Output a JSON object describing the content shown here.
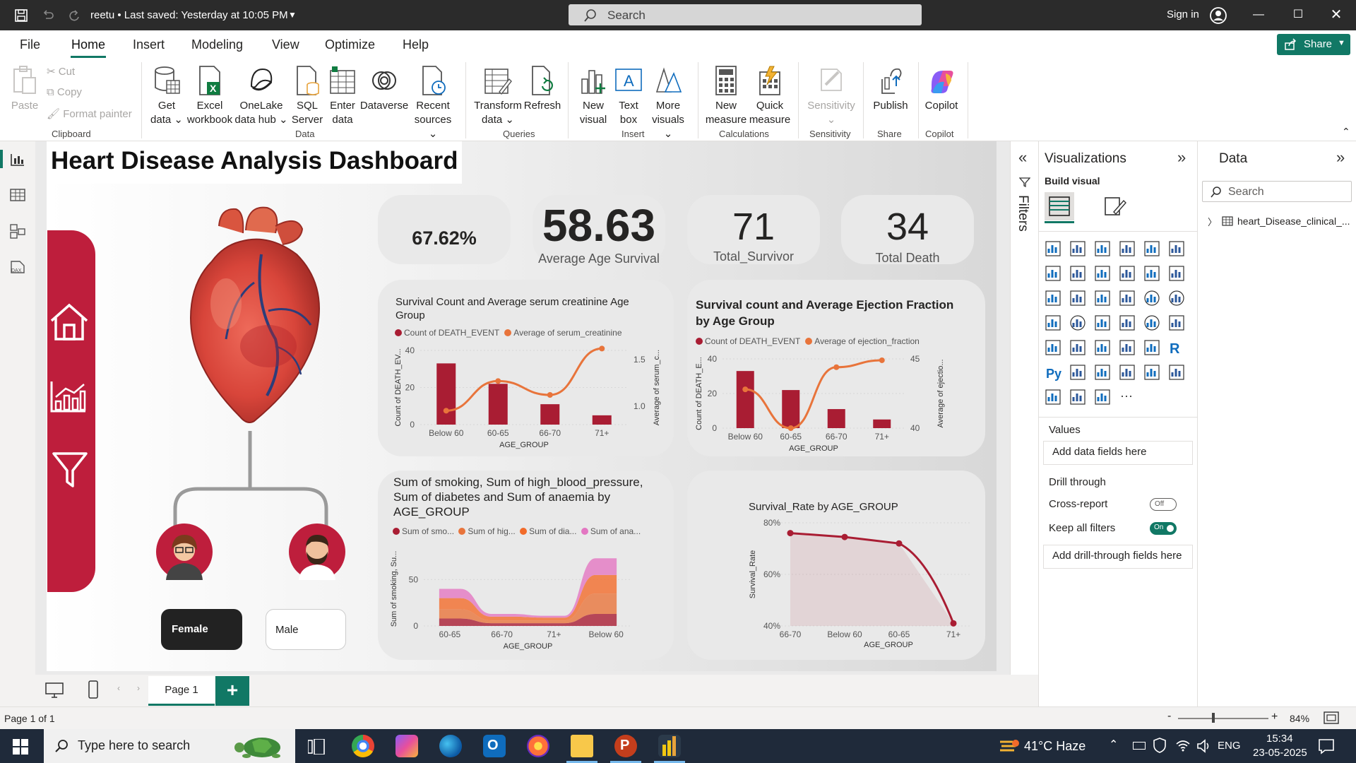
{
  "titlebar": {
    "doc_title": "reetu • Last saved: Yesterday at 10:05 PM",
    "search_placeholder": "Search",
    "signin": "Sign in"
  },
  "menu": {
    "items": [
      "File",
      "Home",
      "Insert",
      "Modeling",
      "View",
      "Optimize",
      "Help"
    ],
    "active": "Home",
    "share": "Share"
  },
  "ribbon": {
    "clipboard": {
      "paste": "Paste",
      "cut": "Cut",
      "copy": "Copy",
      "format_painter": "Format painter",
      "label": "Clipboard"
    },
    "data": {
      "get_data": [
        "Get",
        "data"
      ],
      "excel": [
        "Excel",
        "workbook"
      ],
      "onelake": [
        "OneLake",
        "data hub"
      ],
      "sql": [
        "SQL",
        "Server"
      ],
      "enter": [
        "Enter",
        "data"
      ],
      "dataverse": [
        "Dataverse",
        ""
      ],
      "recent": [
        "Recent",
        "sources"
      ],
      "label": "Data"
    },
    "queries": {
      "transform": [
        "Transform",
        "data"
      ],
      "refresh": [
        "Refresh",
        ""
      ],
      "label": "Queries"
    },
    "insert": {
      "new_visual": [
        "New",
        "visual"
      ],
      "text_box": [
        "Text",
        "box"
      ],
      "more_visuals": [
        "More",
        "visuals"
      ],
      "label": "Insert"
    },
    "calculations": {
      "new_measure": [
        "New",
        "measure"
      ],
      "quick_measure": [
        "Quick",
        "measure"
      ],
      "label": "Calculations"
    },
    "sensitivity": {
      "btn": "Sensitivity",
      "label": "Sensitivity"
    },
    "share": {
      "publish": "Publish",
      "label": "Share"
    },
    "copilot": {
      "btn": "Copilot",
      "label": "Copilot"
    }
  },
  "report": {
    "title": "Heart Disease Analysis Dashboard",
    "kpis": [
      {
        "value": "67.62%",
        "label": ""
      },
      {
        "value": "58.63",
        "label": "Average Age Survival"
      },
      {
        "value": "71",
        "label": "Total_Survivor"
      },
      {
        "value": "34",
        "label": "Total Death"
      }
    ],
    "gender_buttons": {
      "female": "Female",
      "male": "Male"
    }
  },
  "colors": {
    "bar": "#a91d33",
    "line": "#e8743b",
    "accent": "#be1e3c",
    "teal": "#117865",
    "pink": "#e377c2"
  },
  "chart_data": [
    {
      "type": "bar",
      "title": "Survival Count and Average serum creatinine Age Group",
      "legend": [
        "Count of DEATH_EVENT",
        "Average of serum_creatinine"
      ],
      "categories": [
        "Below 60",
        "60-65",
        "66-70",
        "71+"
      ],
      "series": [
        {
          "name": "Count of DEATH_EVENT",
          "values": [
            33,
            22,
            11,
            5
          ],
          "type": "bar"
        },
        {
          "name": "Average of serum_creatinine",
          "values": [
            0.95,
            1.27,
            1.12,
            1.62
          ],
          "type": "line"
        }
      ],
      "xlabel": "AGE_GROUP",
      "ylabel": "Count of DEATH_EV...",
      "y2label": "Average of serum_c...",
      "yticks": [
        "0",
        "20",
        "40"
      ],
      "y2ticks": [
        "1.0",
        "1.5"
      ],
      "ylim": [
        0,
        40
      ],
      "y2lim": [
        0.8,
        1.6
      ]
    },
    {
      "type": "bar",
      "title": "Survival count and Average Ejection Fraction by Age Group",
      "legend": [
        "Count of DEATH_EVENT",
        "Average of ejection_fraction"
      ],
      "categories": [
        "Below 60",
        "60-65",
        "66-70",
        "71+"
      ],
      "series": [
        {
          "name": "Count of DEATH_EVENT",
          "values": [
            33,
            22,
            11,
            5
          ],
          "type": "bar"
        },
        {
          "name": "Average of ejection_fraction",
          "values": [
            42.8,
            40.0,
            44.4,
            44.9
          ],
          "type": "line"
        }
      ],
      "xlabel": "AGE_GROUP",
      "ylabel": "Count of DEATH_E...",
      "y2label": "Average of ejectio...",
      "yticks": [
        "0",
        "20",
        "40"
      ],
      "y2ticks": [
        "40",
        "45"
      ],
      "ylim": [
        0,
        40
      ],
      "y2lim": [
        40,
        45
      ]
    },
    {
      "type": "area",
      "title": "Sum of smoking, Sum of high_blood_pressure, Sum of diabetes and Sum of anaemia by AGE_GROUP",
      "legend": [
        "Sum of smo...",
        "Sum of hig...",
        "Sum of dia...",
        "Sum of ana..."
      ],
      "categories": [
        "60-65",
        "66-70",
        "71+",
        "Below 60"
      ],
      "series": [
        {
          "name": "Sum of smo...",
          "values": [
            8,
            3,
            3,
            13
          ]
        },
        {
          "name": "Sum of hig...",
          "values": [
            10,
            3,
            3,
            22
          ]
        },
        {
          "name": "Sum of dia...",
          "values": [
            12,
            4,
            3,
            20
          ]
        },
        {
          "name": "Sum of ana...",
          "values": [
            10,
            3,
            2,
            18
          ]
        }
      ],
      "xlabel": "AGE_GROUP",
      "ylabel": "Sum of smoking, Su...",
      "yticks": [
        "0",
        "50"
      ],
      "ylim": [
        0,
        80
      ]
    },
    {
      "type": "line",
      "title": "Survival_Rate by AGE_GROUP",
      "categories": [
        "66-70",
        "Below 60",
        "60-65",
        "71+"
      ],
      "series": [
        {
          "name": "Survival_Rate",
          "values": [
            0.76,
            0.745,
            0.72,
            0.41
          ]
        }
      ],
      "xlabel": "AGE_GROUP",
      "ylabel": "Survival_Rate",
      "yticks": [
        "40%",
        "60%",
        "80%"
      ],
      "ylim": [
        0.4,
        0.8
      ]
    }
  ],
  "filters": {
    "label": "Filters"
  },
  "viz": {
    "title": "Visualizations",
    "build": "Build visual",
    "values": "Values",
    "add_fields": "Add data fields here",
    "drill": "Drill through",
    "cross_report": "Cross-report",
    "cross_state": "Off",
    "keep_filters": "Keep all filters",
    "keep_state": "On",
    "add_drill": "Add drill-through fields here"
  },
  "data_pane": {
    "title": "Data",
    "search": "Search",
    "table": "heart_Disease_clinical_..."
  },
  "pages": {
    "tab": "Page 1"
  },
  "status": {
    "page": "Page 1 of 1",
    "zoom": "84%"
  },
  "taskbar": {
    "search": "Type here to search",
    "weather": "41°C  Haze",
    "lang": "ENG",
    "time": "15:34",
    "date": "23-05-2025"
  }
}
